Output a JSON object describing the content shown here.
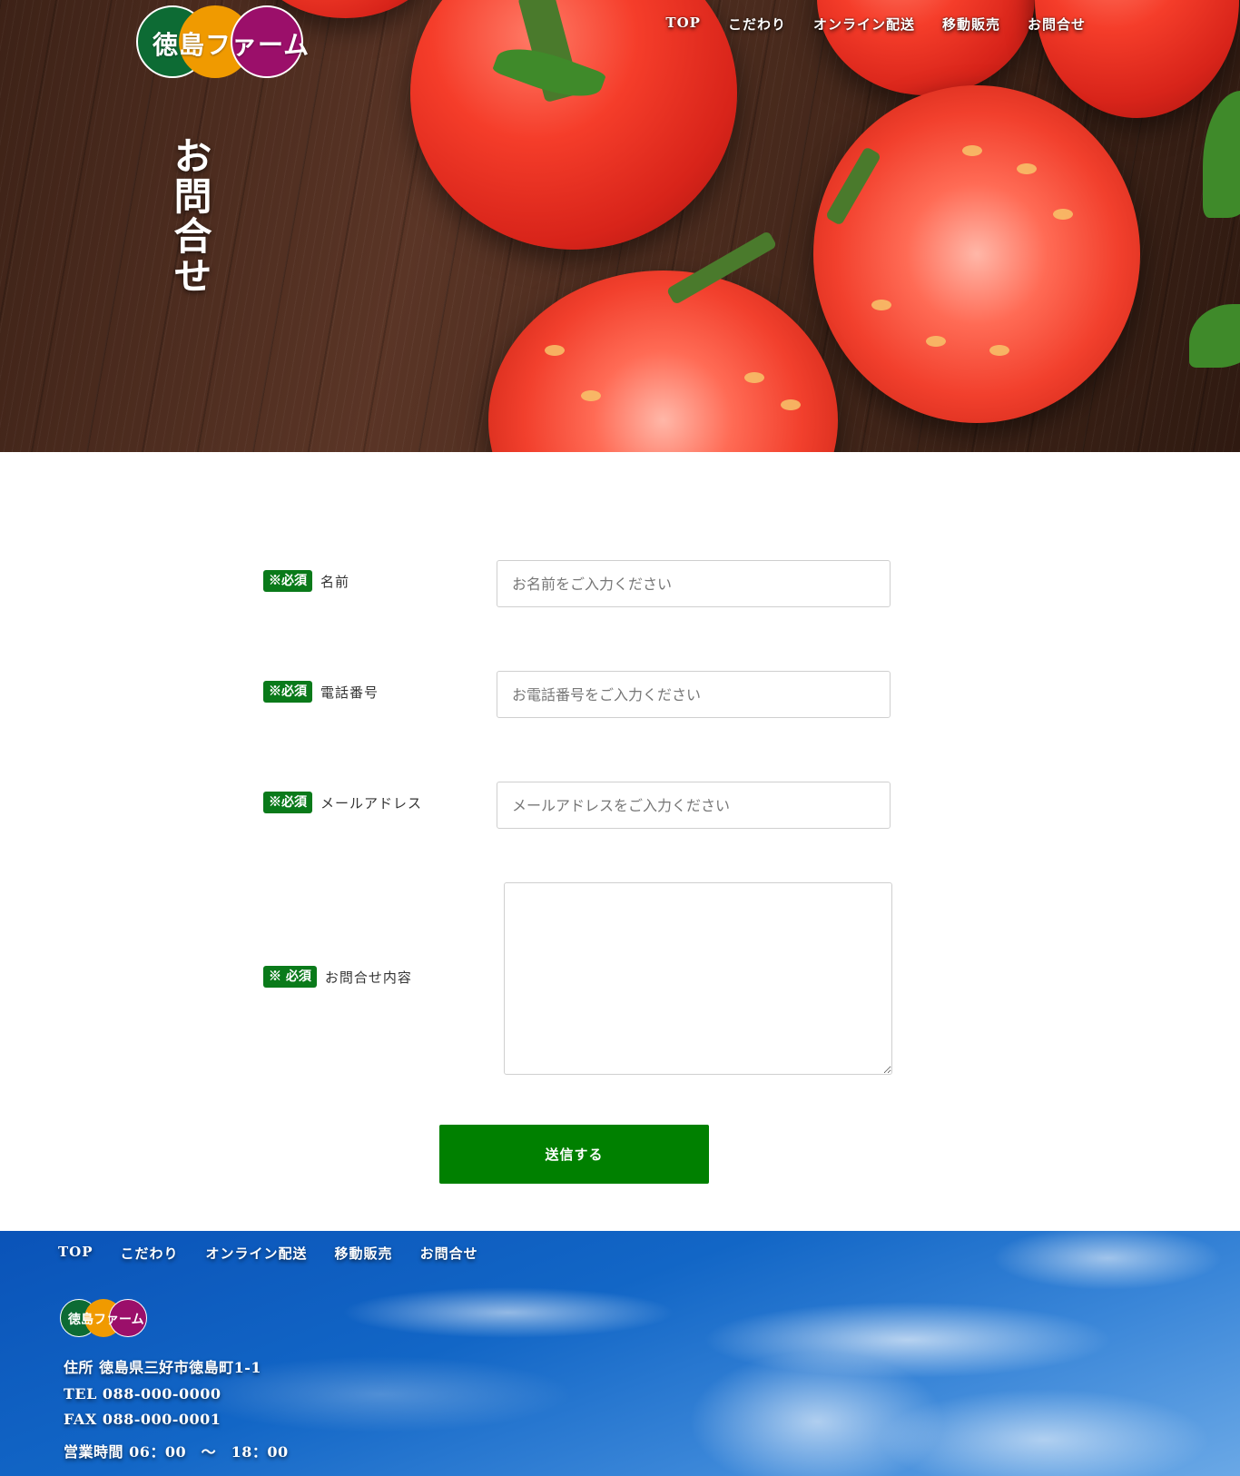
{
  "brand": {
    "name": "徳島ファーム"
  },
  "nav": {
    "items": [
      {
        "label": "TOP"
      },
      {
        "label": "こだわり"
      },
      {
        "label": "オンライン配送"
      },
      {
        "label": "移動販売"
      },
      {
        "label": "お問合せ"
      }
    ]
  },
  "hero": {
    "title": "お問合せ"
  },
  "form": {
    "required_badge": "※必須",
    "required_badge_message": "※ 必須",
    "name": {
      "label": "名前",
      "placeholder": "お名前をご入力ください"
    },
    "phone": {
      "label": "電話番号",
      "placeholder": "お電話番号をご入力ください"
    },
    "email": {
      "label": "メールアドレス",
      "placeholder": "メールアドレスをご入力ください"
    },
    "message": {
      "label": "お問合せ内容"
    },
    "submit_label": "送信する"
  },
  "footer": {
    "nav": [
      {
        "label": "TOP"
      },
      {
        "label": "こだわり"
      },
      {
        "label": "オンライン配送"
      },
      {
        "label": "移動販売"
      },
      {
        "label": "お問合せ"
      }
    ],
    "address": "住所 徳島県三好市徳島町1-1",
    "tel": "TEL 088-000-0000",
    "fax": "FAX 088-000-0001",
    "hours": "営業時間 06：00　〜　18：00"
  },
  "colors": {
    "badge_green": "#0a7a1a",
    "button_green": "#008000",
    "logo_green": "#0d6b34",
    "logo_orange": "#f09a00",
    "logo_magenta": "#9b0f6a"
  }
}
